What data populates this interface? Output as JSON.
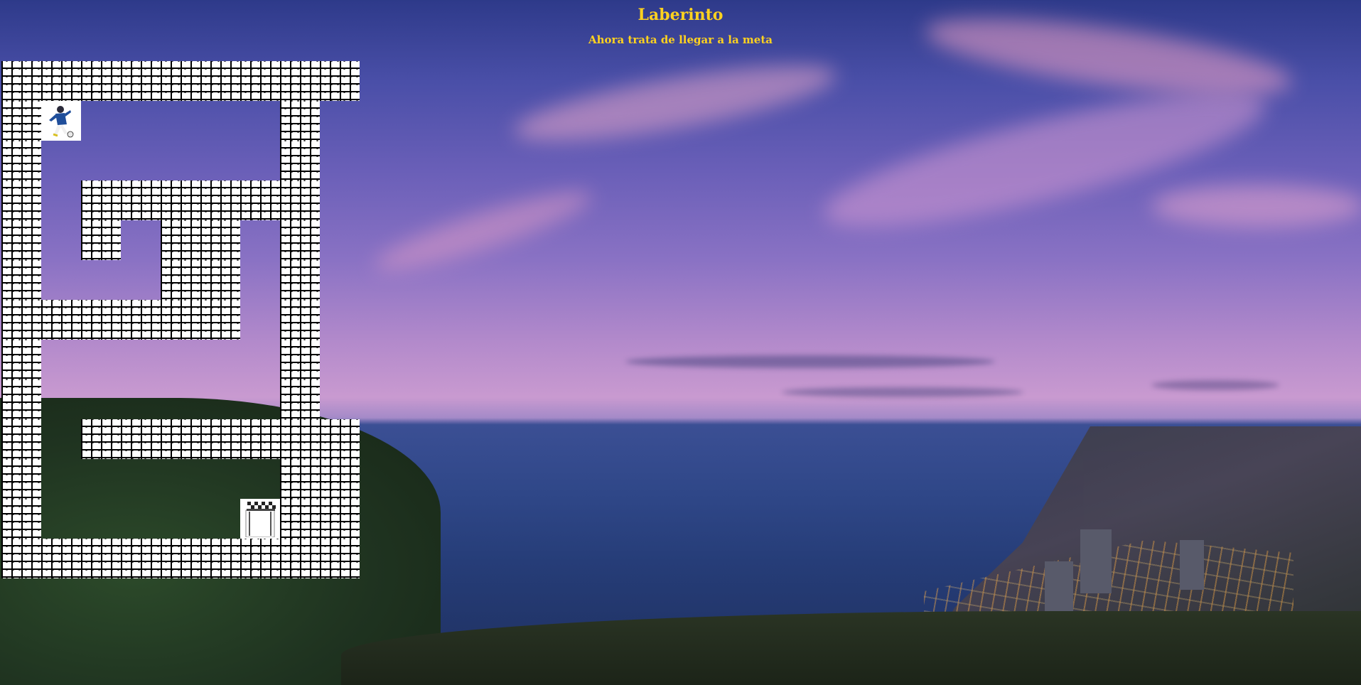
{
  "page": {
    "title": "Laberinto",
    "subtitle": "Ahora trata de llegar a la meta"
  },
  "colors": {
    "heading": "#ffd21f",
    "wall_bg": "#ffffff",
    "wall_pattern": "#000000"
  },
  "maze": {
    "rows": 13,
    "cols": 9,
    "legend": {
      "W": "wall",
      ".": "path",
      "P": "player",
      "G": "goal"
    },
    "grid": [
      "WWWWWWWWW",
      "WP.....W.",
      "W......W.",
      "W.WWWWWW.",
      "W.W.WW.W.",
      "W...WW.W.",
      "WWWWWW.W.",
      "W......W.",
      "W......W.",
      "W.WWWWWWW",
      "W......WW",
      "W.....GWW",
      "WWWWWWWWW"
    ],
    "player_icon": "soccer-player-icon",
    "goal_icon": "checkered-flag-icon"
  }
}
